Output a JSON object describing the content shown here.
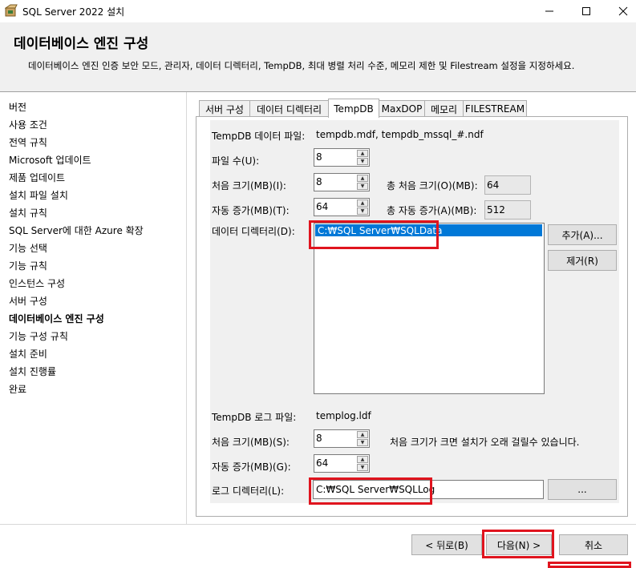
{
  "window": {
    "title": "SQL Server 2022 설치",
    "icon": "sql-setup-box-icon"
  },
  "header": {
    "title": "데이터베이스 엔진 구성",
    "description": "데이터베이스 엔진 인증 보안 모드, 관리자, 데이터 디렉터리, TempDB, 최대 병렬 처리 수준, 메모리 제한 및 Filestream 설정을 지정하세요."
  },
  "nav": {
    "items": [
      "버전",
      "사용 조건",
      "전역 규칙",
      "Microsoft 업데이트",
      "제품 업데이트",
      "설치 파일 설치",
      "설치 규칙",
      "SQL Server에 대한 Azure 확장",
      "기능 선택",
      "기능 규칙",
      "인스턴스 구성",
      "서버 구성",
      "데이터베이스 엔진 구성",
      "기능 구성 규칙",
      "설치 준비",
      "설치 진행률",
      "완료"
    ],
    "active_index": 12
  },
  "tabs": [
    "서버 구성",
    "데이터 디렉터리",
    "TempDB",
    "MaxDOP",
    "메모리",
    "FILESTREAM"
  ],
  "tempdb": {
    "data_files_label": "TempDB 데이터 파일:",
    "data_files_value": "tempdb.mdf, tempdb_mssql_#.ndf",
    "file_count_label": "파일 수(U):",
    "file_count": "8",
    "initial_size_label": "처음 크기(MB)(I):",
    "initial_size": "8",
    "total_initial_label": "총 처음 크기(O)(MB):",
    "total_initial": "64",
    "autogrowth_label": "자동 증가(MB)(T):",
    "autogrowth": "64",
    "total_autogrowth_label": "총 자동 증가(A)(MB):",
    "total_autogrowth": "512",
    "data_dirs_label": "데이터 디렉터리(D):",
    "data_dirs": [
      "C:₩SQL Server₩SQLData"
    ],
    "add_button": "추가(A)...",
    "remove_button": "제거(R)",
    "log_file_label": "TempDB 로그 파일:",
    "log_file_value": "templog.ldf",
    "log_initial_label": "처음 크기(MB)(S):",
    "log_initial": "8",
    "log_warning": "처음 크기가 크면 설치가 오래 걸릴수 있습니다.",
    "log_autogrowth_label": "자동 증가(MB)(G):",
    "log_autogrowth": "64",
    "log_dir_label": "로그 디렉터리(L):",
    "log_dir": "C:₩SQL Server₩SQLLog",
    "browse_button": "..."
  },
  "footer": {
    "back": "< 뒤로(B)",
    "next": "다음(N) >",
    "cancel": "취소"
  },
  "highlight_color": "#e0141e",
  "selection_color": "#0078d7"
}
